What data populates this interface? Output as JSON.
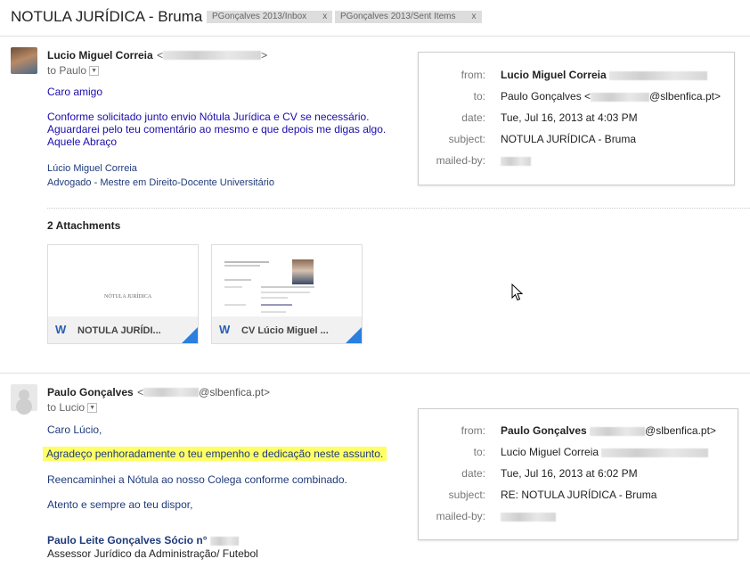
{
  "thread": {
    "subject": "NOTULA JURÍDICA - Bruma",
    "labels": [
      {
        "text": "PGonçalves 2013/Inbox",
        "close": "x"
      },
      {
        "text": "PGonçalves 2013/Sent Items",
        "close": "x"
      }
    ]
  },
  "message1": {
    "sender_name": "Lucio Miguel Correia",
    "sender_email_open": "<",
    "sender_email_close": ">",
    "to_line": "to Paulo",
    "greeting": "Caro amigo",
    "body_lines": [
      "Conforme solicitado junto envio Nótula Jurídica e CV se necessário.",
      "Aguardarei pelo teu comentário ao mesmo e que depois me digas algo.",
      "Aquele Abraço"
    ],
    "signature": [
      "Lúcio Miguel Correia",
      "Advogado - Mestre em Direito-Docente Universitário"
    ],
    "details": {
      "from_label": "from:",
      "from_value": "Lucio Miguel Correia",
      "to_label": "to:",
      "to_value_prefix": "Paulo Gonçalves <",
      "to_value_suffix": "@slbenfica.pt>",
      "date_label": "date:",
      "date_value": "Tue, Jul 16, 2013 at 4:03 PM",
      "subject_label": "subject:",
      "subject_value": "NOTULA JURÍDICA - Bruma",
      "mailed_by_label": "mailed-by:"
    },
    "attachments_title": "2 Attachments",
    "attachments": [
      {
        "name": "NOTULA JURÍDI...",
        "icon": "word-icon",
        "preview_text": "NÓTULA JURÍDICA"
      },
      {
        "name": "CV Lúcio Miguel ...",
        "icon": "word-icon",
        "preview_text": ""
      }
    ]
  },
  "message2": {
    "sender_name": "Paulo Gonçalves",
    "sender_email_open": "<",
    "sender_email_suffix": "@slbenfica.pt>",
    "to_line": "to Lucio",
    "greeting": "Caro Lúcio,",
    "highlight_line": "Agradeço penhoradamente o teu empenho e dedicação neste assunto.",
    "line2": "Reencaminhei a Nótula ao nosso Colega conforme combinado.",
    "line3": "Atento e sempre ao teu dispor,",
    "sig_name": "Paulo Leite Gonçalves Sócio n°",
    "sig_title": "Assessor Jurídico da Administração/ Futebol",
    "details": {
      "from_label": "from:",
      "from_value": "Paulo Gonçalves",
      "from_suffix": "@slbenfica.pt>",
      "to_label": "to:",
      "to_value": "Lucio Miguel Correia",
      "date_label": "date:",
      "date_value": "Tue, Jul 16, 2013 at 6:02 PM",
      "subject_label": "subject:",
      "subject_value": "RE: NOTULA JURÍDICA - Bruma",
      "mailed_by_label": "mailed-by:"
    }
  },
  "colors": {
    "link_blue": "#1a0dab",
    "signature_navy": "#1f3a7a",
    "highlight": "#ffff66",
    "attachment_corner": "#2a7fe0"
  }
}
